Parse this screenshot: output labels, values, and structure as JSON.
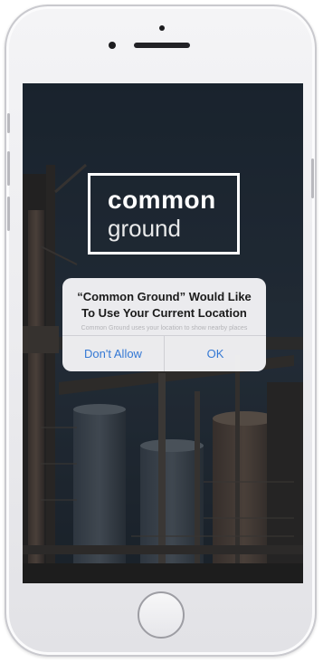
{
  "app": {
    "logo_line1": "common",
    "logo_line2": "ground"
  },
  "alert": {
    "title": "“Common Ground” Would Like\nTo Use Your Current Location",
    "message": "Common Ground uses your location to show nearby places",
    "buttons": {
      "deny_label": "Don't Allow",
      "allow_label": "OK"
    }
  },
  "colors": {
    "alert_button_text": "#3478d4",
    "screen_background": "#1b2530",
    "device_body": "#ececef"
  }
}
